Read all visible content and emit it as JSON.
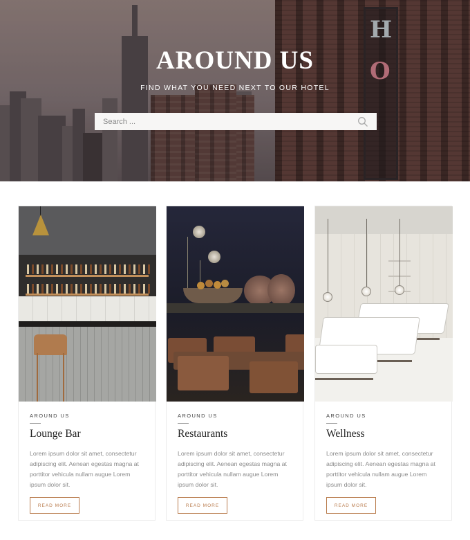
{
  "hero": {
    "title": "AROUND US",
    "subtitle": "FIND WHAT YOU NEED NEXT TO OUR HOTEL",
    "search_placeholder": "Search ...",
    "sign_letters": [
      "H",
      "O"
    ]
  },
  "cards": [
    {
      "eyebrow": "AROUND US",
      "title": "Lounge Bar",
      "text": "Lorem ipsum dolor sit amet, consectetur adipiscing elit. Aenean egestas magna at porttitor vehicula nullam augue Lorem ipsum dolor sit.",
      "button": "READ MORE",
      "image": "lounge-bar-photo"
    },
    {
      "eyebrow": "AROUND US",
      "title": "Restaurants",
      "text": "Lorem ipsum dolor sit amet, consectetur adipiscing elit. Aenean egestas magna at porttitor vehicula nullam augue Lorem ipsum dolor sit.",
      "button": "READ MORE",
      "image": "restaurant-photo"
    },
    {
      "eyebrow": "AROUND US",
      "title": "Wellness",
      "text": "Lorem ipsum dolor sit amet, consectetur adipiscing elit. Aenean egestas magna at porttitor vehicula nullam augue Lorem ipsum dolor sit.",
      "button": "READ MORE",
      "image": "wellness-photo"
    }
  ],
  "colors": {
    "accent": "#b87a4b",
    "hero_overlay": "#6e6466"
  },
  "icons": {
    "search": "search-icon"
  }
}
